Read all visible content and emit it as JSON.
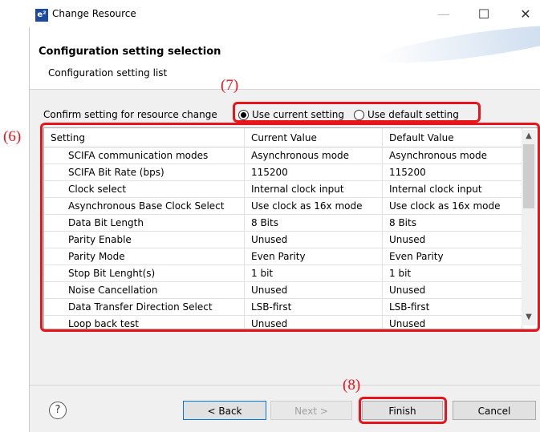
{
  "window": {
    "title": "Change Resource",
    "app_icon": "e²"
  },
  "header": {
    "title": "Configuration setting selection",
    "subtitle": "Configuration setting list"
  },
  "confirm": {
    "label": "Confirm setting for resource change",
    "options": [
      {
        "label": "Use current setting",
        "selected": true
      },
      {
        "label": "Use default setting",
        "selected": false
      }
    ]
  },
  "table": {
    "columns": [
      "Setting",
      "Current Value",
      "Default Value"
    ],
    "rows": [
      [
        "SCIFA communication modes",
        "Asynchronous mode",
        "Asynchronous mode"
      ],
      [
        "SCIFA Bit Rate (bps)",
        "115200",
        "115200"
      ],
      [
        "Clock select",
        "Internal clock input",
        "Internal clock input"
      ],
      [
        "Asynchronous Base Clock Select",
        "Use clock as 16x mode",
        "Use clock as 16x mode"
      ],
      [
        "Data Bit Length",
        "8 Bits",
        "8 Bits"
      ],
      [
        "Parity Enable",
        "Unused",
        "Unused"
      ],
      [
        "Parity Mode",
        "Even Parity",
        "Even Parity"
      ],
      [
        "Stop Bit Lenght(s)",
        "1 bit",
        "1 bit"
      ],
      [
        "Noise Cancellation",
        "Unused",
        "Unused"
      ],
      [
        "Data Transfer Direction Select",
        "LSB-first",
        "LSB-first"
      ],
      [
        "Loop back test",
        "Unused",
        "Unused"
      ]
    ]
  },
  "buttons": {
    "help": "?",
    "back": "< Back",
    "next": "Next >",
    "finish": "Finish",
    "cancel": "Cancel"
  },
  "annotations": {
    "six": "(6)",
    "seven": "(7)",
    "eight": "(8)"
  },
  "colors": {
    "annotation": "#e8141b",
    "accent": "#0078d7"
  }
}
